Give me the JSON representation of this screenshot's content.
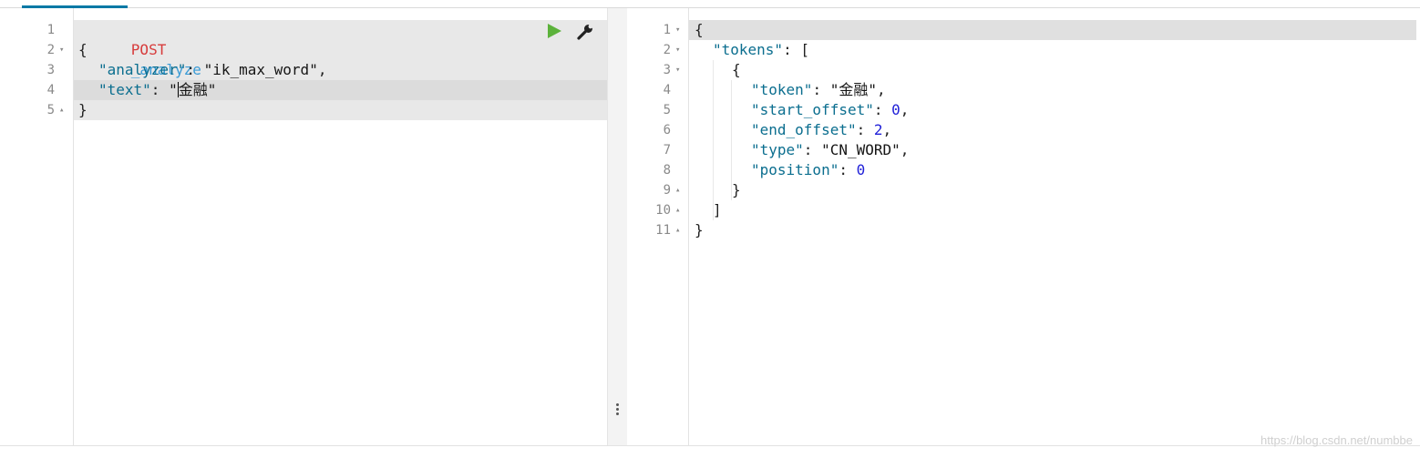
{
  "request_editor": {
    "lines": [
      {
        "num": "1",
        "fold": "",
        "method": "POST",
        "url": "_analyze"
      },
      {
        "num": "2",
        "fold": "▾",
        "text": "{"
      },
      {
        "num": "3",
        "fold": "",
        "key": "\"analyzer\"",
        "sep": ": ",
        "value": "\"ik_max_word\"",
        "tail": ","
      },
      {
        "num": "4",
        "fold": "",
        "key": "\"text\"",
        "sep": ": ",
        "value_open": "\"",
        "value_rest": "金融\""
      },
      {
        "num": "5",
        "fold": "▴",
        "text": "}"
      }
    ],
    "run_icon": "play-icon",
    "settings_icon": "wrench-icon"
  },
  "response_viewer": {
    "lines": [
      {
        "num": "1",
        "fold": "▾",
        "text": "{"
      },
      {
        "num": "2",
        "fold": "▾",
        "key": "\"tokens\"",
        "sep": ": ",
        "tail": "["
      },
      {
        "num": "3",
        "fold": "▾",
        "text": "{"
      },
      {
        "num": "4",
        "fold": "",
        "key": "\"token\"",
        "sep": ": ",
        "value": "\"金融\"",
        "tail": ","
      },
      {
        "num": "5",
        "fold": "",
        "key": "\"start_offset\"",
        "sep": ": ",
        "num_value": "0",
        "tail": ","
      },
      {
        "num": "6",
        "fold": "",
        "key": "\"end_offset\"",
        "sep": ": ",
        "num_value": "2",
        "tail": ","
      },
      {
        "num": "7",
        "fold": "",
        "key": "\"type\"",
        "sep": ": ",
        "value": "\"CN_WORD\"",
        "tail": ","
      },
      {
        "num": "8",
        "fold": "",
        "key": "\"position\"",
        "sep": ": ",
        "num_value": "0",
        "tail": ""
      },
      {
        "num": "9",
        "fold": "▴",
        "text": "}"
      },
      {
        "num": "10",
        "fold": "▴",
        "text": "]"
      },
      {
        "num": "11",
        "fold": "▴",
        "text": "}"
      }
    ]
  },
  "colors": {
    "accent": "#0079a5",
    "method": "#d73c3c",
    "url": "#3a9bd6",
    "json_key": "#0b6e8f",
    "number": "#2020d8",
    "run_button": "#5cb23b"
  },
  "watermark": "https://blog.csdn.net/numbbe"
}
